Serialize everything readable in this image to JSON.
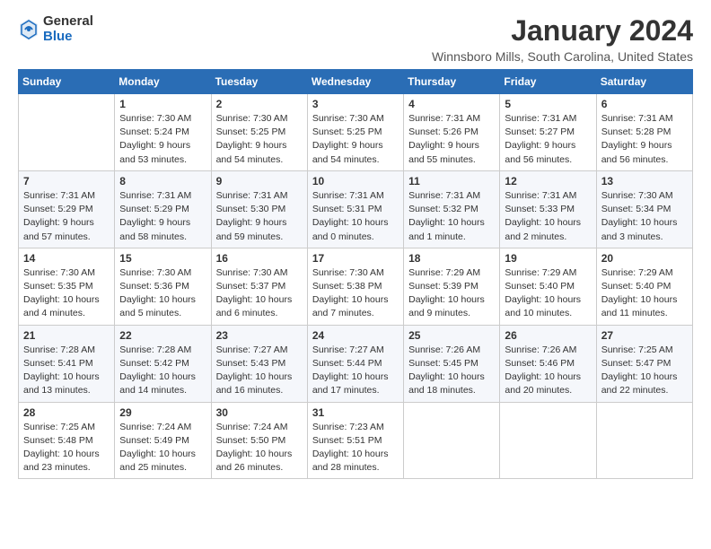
{
  "header": {
    "logo_general": "General",
    "logo_blue": "Blue",
    "title": "January 2024",
    "location": "Winnsboro Mills, South Carolina, United States"
  },
  "days_of_week": [
    "Sunday",
    "Monday",
    "Tuesday",
    "Wednesday",
    "Thursday",
    "Friday",
    "Saturday"
  ],
  "weeks": [
    [
      {
        "day": "",
        "info": ""
      },
      {
        "day": "1",
        "info": "Sunrise: 7:30 AM\nSunset: 5:24 PM\nDaylight: 9 hours\nand 53 minutes."
      },
      {
        "day": "2",
        "info": "Sunrise: 7:30 AM\nSunset: 5:25 PM\nDaylight: 9 hours\nand 54 minutes."
      },
      {
        "day": "3",
        "info": "Sunrise: 7:30 AM\nSunset: 5:25 PM\nDaylight: 9 hours\nand 54 minutes."
      },
      {
        "day": "4",
        "info": "Sunrise: 7:31 AM\nSunset: 5:26 PM\nDaylight: 9 hours\nand 55 minutes."
      },
      {
        "day": "5",
        "info": "Sunrise: 7:31 AM\nSunset: 5:27 PM\nDaylight: 9 hours\nand 56 minutes."
      },
      {
        "day": "6",
        "info": "Sunrise: 7:31 AM\nSunset: 5:28 PM\nDaylight: 9 hours\nand 56 minutes."
      }
    ],
    [
      {
        "day": "7",
        "info": "Sunrise: 7:31 AM\nSunset: 5:29 PM\nDaylight: 9 hours\nand 57 minutes."
      },
      {
        "day": "8",
        "info": "Sunrise: 7:31 AM\nSunset: 5:29 PM\nDaylight: 9 hours\nand 58 minutes."
      },
      {
        "day": "9",
        "info": "Sunrise: 7:31 AM\nSunset: 5:30 PM\nDaylight: 9 hours\nand 59 minutes."
      },
      {
        "day": "10",
        "info": "Sunrise: 7:31 AM\nSunset: 5:31 PM\nDaylight: 10 hours\nand 0 minutes."
      },
      {
        "day": "11",
        "info": "Sunrise: 7:31 AM\nSunset: 5:32 PM\nDaylight: 10 hours\nand 1 minute."
      },
      {
        "day": "12",
        "info": "Sunrise: 7:31 AM\nSunset: 5:33 PM\nDaylight: 10 hours\nand 2 minutes."
      },
      {
        "day": "13",
        "info": "Sunrise: 7:30 AM\nSunset: 5:34 PM\nDaylight: 10 hours\nand 3 minutes."
      }
    ],
    [
      {
        "day": "14",
        "info": "Sunrise: 7:30 AM\nSunset: 5:35 PM\nDaylight: 10 hours\nand 4 minutes."
      },
      {
        "day": "15",
        "info": "Sunrise: 7:30 AM\nSunset: 5:36 PM\nDaylight: 10 hours\nand 5 minutes."
      },
      {
        "day": "16",
        "info": "Sunrise: 7:30 AM\nSunset: 5:37 PM\nDaylight: 10 hours\nand 6 minutes."
      },
      {
        "day": "17",
        "info": "Sunrise: 7:30 AM\nSunset: 5:38 PM\nDaylight: 10 hours\nand 7 minutes."
      },
      {
        "day": "18",
        "info": "Sunrise: 7:29 AM\nSunset: 5:39 PM\nDaylight: 10 hours\nand 9 minutes."
      },
      {
        "day": "19",
        "info": "Sunrise: 7:29 AM\nSunset: 5:40 PM\nDaylight: 10 hours\nand 10 minutes."
      },
      {
        "day": "20",
        "info": "Sunrise: 7:29 AM\nSunset: 5:40 PM\nDaylight: 10 hours\nand 11 minutes."
      }
    ],
    [
      {
        "day": "21",
        "info": "Sunrise: 7:28 AM\nSunset: 5:41 PM\nDaylight: 10 hours\nand 13 minutes."
      },
      {
        "day": "22",
        "info": "Sunrise: 7:28 AM\nSunset: 5:42 PM\nDaylight: 10 hours\nand 14 minutes."
      },
      {
        "day": "23",
        "info": "Sunrise: 7:27 AM\nSunset: 5:43 PM\nDaylight: 10 hours\nand 16 minutes."
      },
      {
        "day": "24",
        "info": "Sunrise: 7:27 AM\nSunset: 5:44 PM\nDaylight: 10 hours\nand 17 minutes."
      },
      {
        "day": "25",
        "info": "Sunrise: 7:26 AM\nSunset: 5:45 PM\nDaylight: 10 hours\nand 18 minutes."
      },
      {
        "day": "26",
        "info": "Sunrise: 7:26 AM\nSunset: 5:46 PM\nDaylight: 10 hours\nand 20 minutes."
      },
      {
        "day": "27",
        "info": "Sunrise: 7:25 AM\nSunset: 5:47 PM\nDaylight: 10 hours\nand 22 minutes."
      }
    ],
    [
      {
        "day": "28",
        "info": "Sunrise: 7:25 AM\nSunset: 5:48 PM\nDaylight: 10 hours\nand 23 minutes."
      },
      {
        "day": "29",
        "info": "Sunrise: 7:24 AM\nSunset: 5:49 PM\nDaylight: 10 hours\nand 25 minutes."
      },
      {
        "day": "30",
        "info": "Sunrise: 7:24 AM\nSunset: 5:50 PM\nDaylight: 10 hours\nand 26 minutes."
      },
      {
        "day": "31",
        "info": "Sunrise: 7:23 AM\nSunset: 5:51 PM\nDaylight: 10 hours\nand 28 minutes."
      },
      {
        "day": "",
        "info": ""
      },
      {
        "day": "",
        "info": ""
      },
      {
        "day": "",
        "info": ""
      }
    ]
  ]
}
